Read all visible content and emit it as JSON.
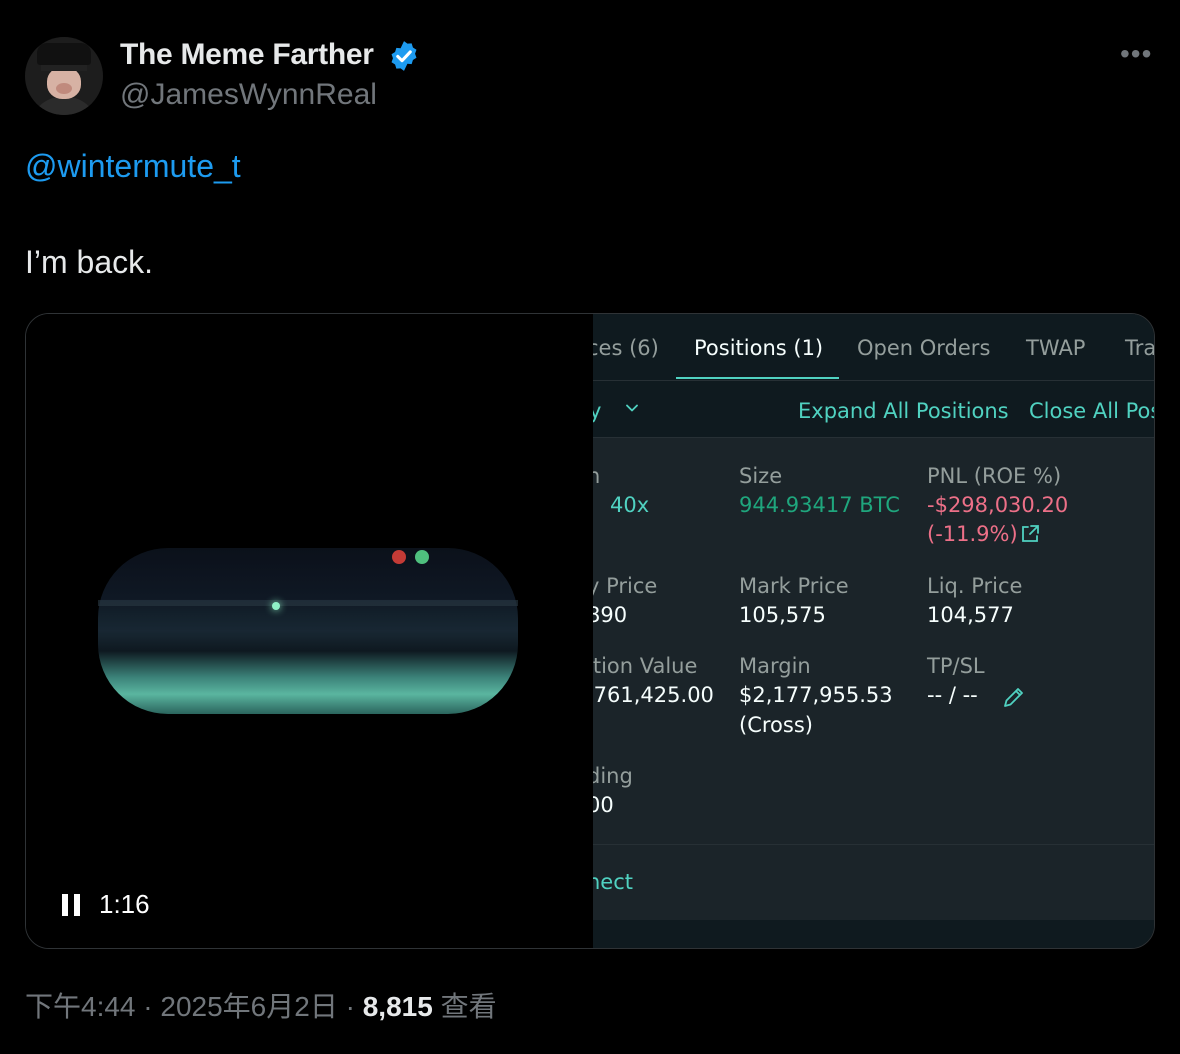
{
  "author": {
    "display_name": "The Meme Farther",
    "handle": "@JamesWynnReal",
    "verified": true,
    "verified_color": "#1d9bf0"
  },
  "tweet": {
    "mention": "@wintermute_t",
    "text": "I’m back."
  },
  "video": {
    "duration": "1:16",
    "state": "playing"
  },
  "trading_panel": {
    "tabs": [
      {
        "label": "ces (6)",
        "active": false
      },
      {
        "label": "Positions (1)",
        "active": true
      },
      {
        "label": "Open Orders",
        "active": false
      },
      {
        "label": "TWAP",
        "active": false
      },
      {
        "label": "Tra",
        "active": false
      }
    ],
    "toolbar": {
      "filter_label": "y",
      "expand_all": "Expand All Positions",
      "close_all": "Close All Pos"
    },
    "fields": {
      "coin_label": "n",
      "coin_value": "40x",
      "size_label": "Size",
      "size_value": "944.93417 BTC",
      "pnl_label": "PNL (ROE %)",
      "pnl_value": "-$298,030.20",
      "pnl_roe": "(-11.9%)",
      "entry_label": "y Price",
      "entry_value": "890",
      "mark_label": "Mark Price",
      "mark_value": "105,575",
      "liq_label": "Liq. Price",
      "liq_value": "104,577",
      "pos_value_label": "ition Value",
      "pos_value": ",761,425.00",
      "margin_label": "Margin",
      "margin_value": "$2,177,955.53",
      "margin_mode": "(Cross)",
      "tpsl_label": "TP/SL",
      "tpsl_value": "-- / --",
      "funding_label": "ding",
      "funding_value": "00"
    },
    "footer_link": "nect",
    "colors": {
      "accent": "#50d2c1",
      "profit": "#1fa67d",
      "loss": "#ed7088"
    }
  },
  "meta": {
    "time": "下午4:44",
    "separator1": "·",
    "date": "2025年6月2日",
    "separator2": "·",
    "views_count": "8,815",
    "views_label": "查看"
  }
}
